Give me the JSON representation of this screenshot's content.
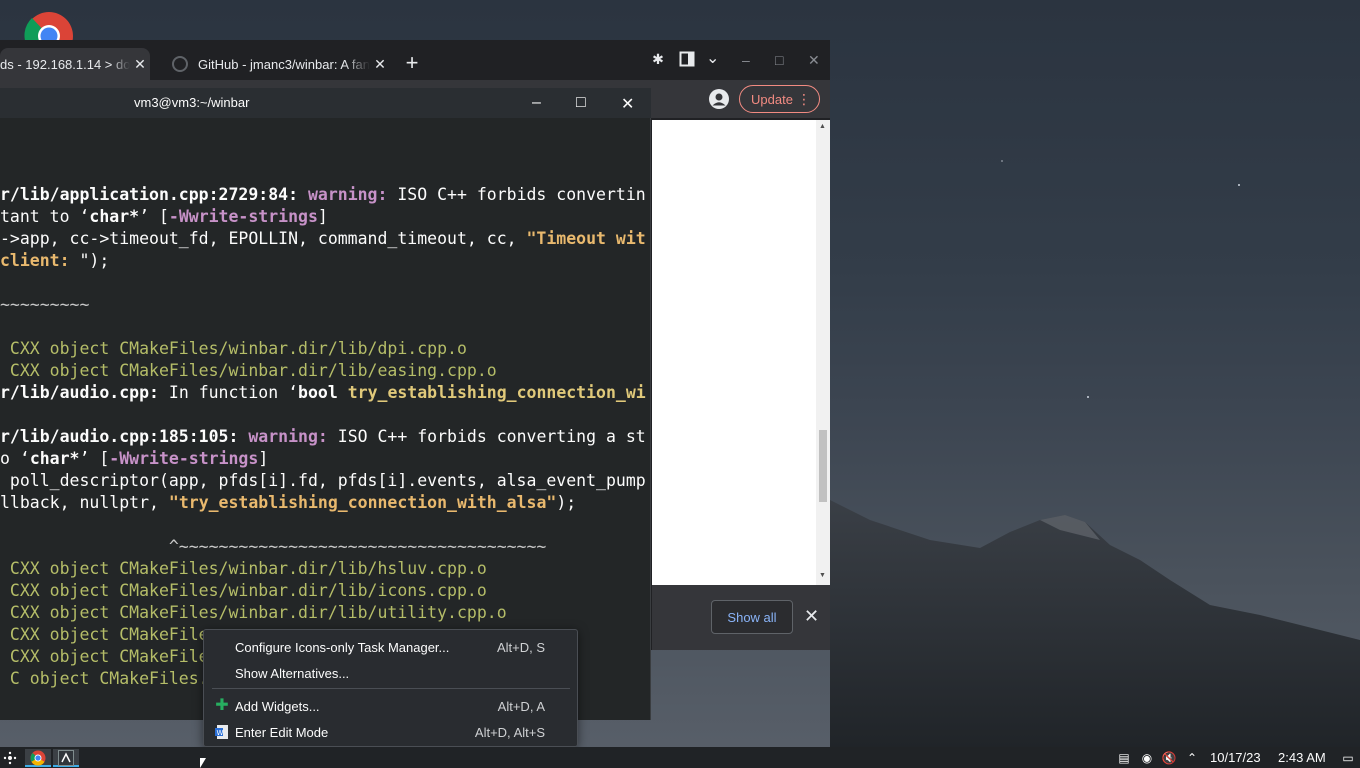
{
  "browser": {
    "tabs": [
      {
        "label": "ds - 192.168.1.14 > do",
        "close": "✕"
      },
      {
        "label": "GitHub - jmanc3/winbar: A fan",
        "close": "✕"
      }
    ],
    "new_tab": "+",
    "tab_search": "⌄",
    "update_label": "Update",
    "show_all_label": "Show all",
    "download_close": "✕"
  },
  "terminal": {
    "title": "vm3@vm3:~/winbar",
    "lines": [
      {
        "segments": [
          {
            "t": "                                                                  ^~~~~~~~~~~~",
            "c": ""
          }
        ],
        "cls": "dim"
      },
      {
        "segments": [
          {
            "t": "",
            "c": ""
          }
        ],
        "cls": ""
      },
      {
        "segments": [
          {
            "t": "",
            "c": ""
          }
        ],
        "cls": ""
      },
      {
        "segments": [
          {
            "t": "r/lib/application.cpp:2729:84: ",
            "c": "b"
          },
          {
            "t": "warning: ",
            "c": "warn"
          },
          {
            "t": "ISO C++ forbids convertin",
            "c": ""
          }
        ],
        "cls": ""
      },
      {
        "segments": [
          {
            "t": "tant to ‘",
            "c": ""
          },
          {
            "t": "char*",
            "c": "b"
          },
          {
            "t": "’ [",
            "c": ""
          },
          {
            "t": "-Wwrite-strings",
            "c": "warn"
          },
          {
            "t": "]",
            "c": ""
          }
        ],
        "cls": ""
      },
      {
        "segments": [
          {
            "t": "->app, cc->timeout_fd, EPOLLIN, command_timeout, cc, ",
            "c": ""
          },
          {
            "t": "\"Timeout wit",
            "c": "str"
          }
        ],
        "cls": ""
      },
      {
        "segments": [
          {
            "t": "client: ",
            "c": "str"
          },
          {
            "t": "\");",
            "c": ""
          }
        ],
        "cls": ""
      },
      {
        "segments": [
          {
            "t": "                                                                  ^~~~~~~~~~~~",
            "c": ""
          }
        ],
        "cls": "dim"
      },
      {
        "segments": [
          {
            "t": "~~~~~~~~~",
            "c": ""
          }
        ],
        "cls": "dim"
      },
      {
        "segments": [
          {
            "t": "",
            "c": ""
          }
        ],
        "cls": ""
      },
      {
        "segments": [
          {
            "t": " CXX object CMakeFiles/winbar.dir/lib/dpi.cpp.o",
            "c": ""
          }
        ],
        "cls": "green"
      },
      {
        "segments": [
          {
            "t": " CXX object CMakeFiles/winbar.dir/lib/easing.cpp.o",
            "c": ""
          }
        ],
        "cls": "green"
      },
      {
        "segments": [
          {
            "t": "r/lib/audio.cpp: ",
            "c": "b"
          },
          {
            "t": "In function ‘",
            "c": ""
          },
          {
            "t": "bool ",
            "c": "b"
          },
          {
            "t": "try_establishing_connection_wi",
            "c": "hl"
          }
        ],
        "cls": ""
      },
      {
        "segments": [
          {
            "t": "",
            "c": ""
          }
        ],
        "cls": ""
      },
      {
        "segments": [
          {
            "t": "r/lib/audio.cpp:185:105: ",
            "c": "b"
          },
          {
            "t": "warning: ",
            "c": "warn"
          },
          {
            "t": "ISO C++ forbids converting a st",
            "c": ""
          }
        ],
        "cls": ""
      },
      {
        "segments": [
          {
            "t": "o ‘",
            "c": ""
          },
          {
            "t": "char*",
            "c": "b"
          },
          {
            "t": "’ [",
            "c": ""
          },
          {
            "t": "-Wwrite-strings",
            "c": "warn"
          },
          {
            "t": "]",
            "c": ""
          }
        ],
        "cls": ""
      },
      {
        "segments": [
          {
            "t": " poll_descriptor(app, pfds[i].fd, pfds[i].events, alsa_event_pump",
            "c": ""
          }
        ],
        "cls": ""
      },
      {
        "segments": [
          {
            "t": "llback, nullptr, ",
            "c": ""
          },
          {
            "t": "\"try_establishing_connection_with_alsa\"",
            "c": "str"
          },
          {
            "t": ");",
            "c": ""
          }
        ],
        "cls": ""
      },
      {
        "segments": [
          {
            "t": "",
            "c": ""
          }
        ],
        "cls": ""
      },
      {
        "segments": [
          {
            "t": "                 ^~~~~~~~~~~~~~~~~~~~~~~~~~~~~~~~~~~~~~",
            "c": ""
          }
        ],
        "cls": "dim"
      },
      {
        "segments": [
          {
            "t": " CXX object CMakeFiles/winbar.dir/lib/hsluv.cpp.o",
            "c": ""
          }
        ],
        "cls": "green"
      },
      {
        "segments": [
          {
            "t": " CXX object CMakeFiles/winbar.dir/lib/icons.cpp.o",
            "c": ""
          }
        ],
        "cls": "green"
      },
      {
        "segments": [
          {
            "t": " CXX object CMakeFiles/winbar.dir/lib/utility.cpp.o",
            "c": ""
          }
        ],
        "cls": "green"
      },
      {
        "segments": [
          {
            "t": " CXX object CMakeFile",
            "c": ""
          }
        ],
        "cls": "green"
      },
      {
        "segments": [
          {
            "t": " CXX object CMakeFile",
            "c": ""
          }
        ],
        "cls": "green"
      },
      {
        "segments": [
          {
            "t": " C object CMakeFiles.",
            "c": ""
          }
        ],
        "cls": "green"
      }
    ]
  },
  "context_menu": {
    "items": [
      {
        "label": "Configure Icons-only Task Manager...",
        "shortcut": "Alt+D, S",
        "icon": ""
      },
      {
        "label": "Show Alternatives...",
        "shortcut": "",
        "icon": ""
      },
      {
        "label": "Add Widgets...",
        "shortcut": "Alt+D, A",
        "icon": "plus-icon"
      },
      {
        "label": "Enter Edit Mode",
        "shortcut": "Alt+D, Alt+S",
        "icon": "edit-mode-icon"
      }
    ]
  },
  "taskbar": {
    "date": "10/17/23",
    "time": "2:43 AM"
  },
  "colors": {
    "terminal_bg": "#232627",
    "menu_bg": "#292c30",
    "update_accent": "#f28b82",
    "link_blue": "#8ab4f8",
    "green_text": "#b5bd68"
  }
}
